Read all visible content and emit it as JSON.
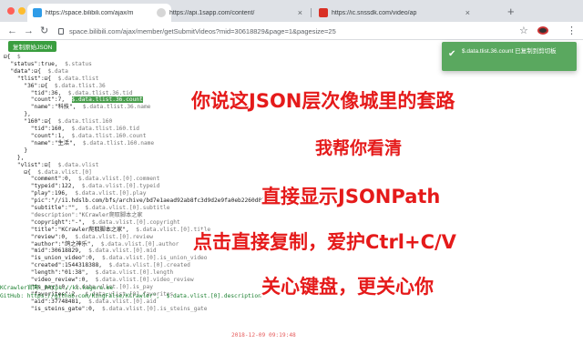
{
  "browser": {
    "tabs": [
      {
        "title": "https://space.bilibili.com/ajax/m",
        "active": true,
        "favicon_color": "#2f9ce8"
      },
      {
        "title": "https://api.1sapp.com/content/",
        "active": false,
        "favicon_color": "#cccccc"
      },
      {
        "title": "https://ic.snssdk.com/video/ap",
        "active": false,
        "favicon_color": "#d93025"
      }
    ],
    "new_tab_label": "+",
    "close_label": "×",
    "url": "space.bilibili.com/ajax/member/getSubmitVideos?mid=30618829&page=1&pagesize=25"
  },
  "toolbar": {
    "back": "←",
    "forward": "→",
    "reload": "↻",
    "star": "☆",
    "menu": "⋮"
  },
  "page": {
    "copy_json_label": "复制原始JSON",
    "json_lines": [
      [
        {
          "t": "⊟{  "
        },
        {
          "t": "$",
          "c": "p"
        }
      ],
      [
        {
          "t": "  \"status\":true,  "
        },
        {
          "t": "$.status",
          "c": "p"
        }
      ],
      [
        {
          "t": "  \"data\":⊟{  "
        },
        {
          "t": "$.data",
          "c": "p"
        }
      ],
      [
        {
          "t": "    \"tlist\":⊟{  "
        },
        {
          "t": "$.data.tlist",
          "c": "p"
        }
      ],
      [
        {
          "t": "      \"36\":⊟{  "
        },
        {
          "t": "$.data.tlist.36",
          "c": "p"
        }
      ],
      [
        {
          "t": "        \"tid\":36,  "
        },
        {
          "t": "$.data.tlist.36.tid",
          "c": "p"
        }
      ],
      [
        {
          "t": "        \"count\":7,  "
        },
        {
          "t": "$.data.tlist.36.count",
          "c": "hl"
        }
      ],
      [
        {
          "t": "        \"name\":\"科技\",  "
        },
        {
          "t": "$.data.tlist.36.name",
          "c": "p"
        }
      ],
      [
        {
          "t": "      },"
        }
      ],
      [
        {
          "t": "      \"160\":⊟{  "
        },
        {
          "t": "$.data.tlist.160",
          "c": "p"
        }
      ],
      [
        {
          "t": "        \"tid\":160,  "
        },
        {
          "t": "$.data.tlist.160.tid",
          "c": "p"
        }
      ],
      [
        {
          "t": "        \"count\":1,  "
        },
        {
          "t": "$.data.tlist.160.count",
          "c": "p"
        }
      ],
      [
        {
          "t": "        \"name\":\"生活\",  "
        },
        {
          "t": "$.data.tlist.160.name",
          "c": "p"
        }
      ],
      [
        {
          "t": "      }"
        }
      ],
      [
        {
          "t": "    },"
        }
      ],
      [
        {
          "t": "    \"vlist\":⊟[  "
        },
        {
          "t": "$.data.vlist",
          "c": "p"
        }
      ],
      [
        {
          "t": "      ⊟{  "
        },
        {
          "t": "$.data.vlist.[0]",
          "c": "p"
        }
      ],
      [
        {
          "t": "        \"comment\":0,  "
        },
        {
          "t": "$.data.vlist.[0].comment",
          "c": "p"
        }
      ],
      [
        {
          "t": "        \"typeid\":122,  "
        },
        {
          "t": "$.data.vlist.[0].typeid",
          "c": "p"
        }
      ],
      [
        {
          "t": "        \"play\":196,  "
        },
        {
          "t": "$.data.vlist.[0].play",
          "c": "p"
        }
      ],
      [
        {
          "t": "        \"pic\":\"//i1.hdslb.com/bfs/archive/bd7e1aead92ab8fc3d9d2e9fa0eb2260d8263850.jpg\",  "
        },
        {
          "t": "$.data.vlist.[0].pic",
          "c": "p"
        }
      ],
      [
        {
          "t": "        \"subtitle\":\"\",  "
        },
        {
          "t": "$.data.vlist.[0].subtitle",
          "c": "p"
        }
      ],
      [
        {
          "t": "        \"description\":\"KCrawler爬取脚本之家",
          "c": "tg"
        }
      ],
      [
        {
          "t": ""
        }
      ],
      [
        {
          "t": ""
        }
      ],
      [
        {
          "t": "        \"copyright\":\"-\",  "
        },
        {
          "t": "$.data.vlist.[0].copyright",
          "c": "p"
        }
      ],
      [
        {
          "t": "        \"title\":\"KCrawler爬取脚本之家\",  "
        },
        {
          "t": "$.data.vlist.[0].title",
          "c": "p"
        }
      ],
      [
        {
          "t": "        \"review\":0,  "
        },
        {
          "t": "$.data.vlist.[0].review",
          "c": "p"
        }
      ],
      [
        {
          "t": "        \"author\":\"鸽之神乐\",  "
        },
        {
          "t": "$.data.vlist.[0].author",
          "c": "p"
        }
      ],
      [
        {
          "t": "        \"mid\":30618829,  "
        },
        {
          "t": "$.data.vlist.[0].mid",
          "c": "p"
        }
      ],
      [
        {
          "t": "        \"is_union_video\":0,  "
        },
        {
          "t": "$.data.vlist.[0].is_union_video",
          "c": "p"
        }
      ],
      [
        {
          "t": "        \"created\":1544318388,  "
        },
        {
          "t": "$.data.vlist.[0].created",
          "c": "p"
        }
      ],
      [
        {
          "t": "        \"length\":\"01:38\",  "
        },
        {
          "t": "$.data.vlist.[0].length",
          "c": "p"
        }
      ],
      [
        {
          "t": "        \"video_review\":0,  "
        },
        {
          "t": "$.data.vlist.[0].video_review",
          "c": "p"
        }
      ],
      [
        {
          "t": "        \"is_pay\":0,  "
        },
        {
          "t": "$.data.vlist.[0].is_pay",
          "c": "p"
        }
      ],
      [
        {
          "t": "        \"favorites\":2,  "
        },
        {
          "t": "$.data.vlist.[0].favorites",
          "c": "p"
        }
      ],
      [
        {
          "t": "        \"aid\":37748481,  "
        },
        {
          "t": "$.data.vlist.[0].aid",
          "c": "p"
        }
      ],
      [
        {
          "t": "        \"is_steins_gate\":0,  "
        },
        {
          "t": "$.data.vlist.[0].is_steins_gate",
          "c": "p"
        }
      ]
    ],
    "description_lines": [
      "KCrawler官网: https://kc.kagura.me",
      "GitHub: https://github.com/KingFalse/KCrawler\",  $.data.vlist.[0].description"
    ],
    "created_date": "2018-12-09 09:19:48"
  },
  "toast": {
    "check": "✔",
    "text": "$.data.tlist.36.count 已复制到剪切板"
  },
  "slogans": [
    "你说这JSON层次像城里的套路",
    "我帮你看清",
    "直接显示JSONPath",
    "点击直接复制，爱护Ctrl+C/V",
    "关心键盘，更关心你"
  ],
  "colors": {
    "slogan": "#e51a1a",
    "toast_bg": "#5aa85f",
    "button_bg": "#3a9e3f",
    "highlight_bg": "#4a9e4e"
  }
}
